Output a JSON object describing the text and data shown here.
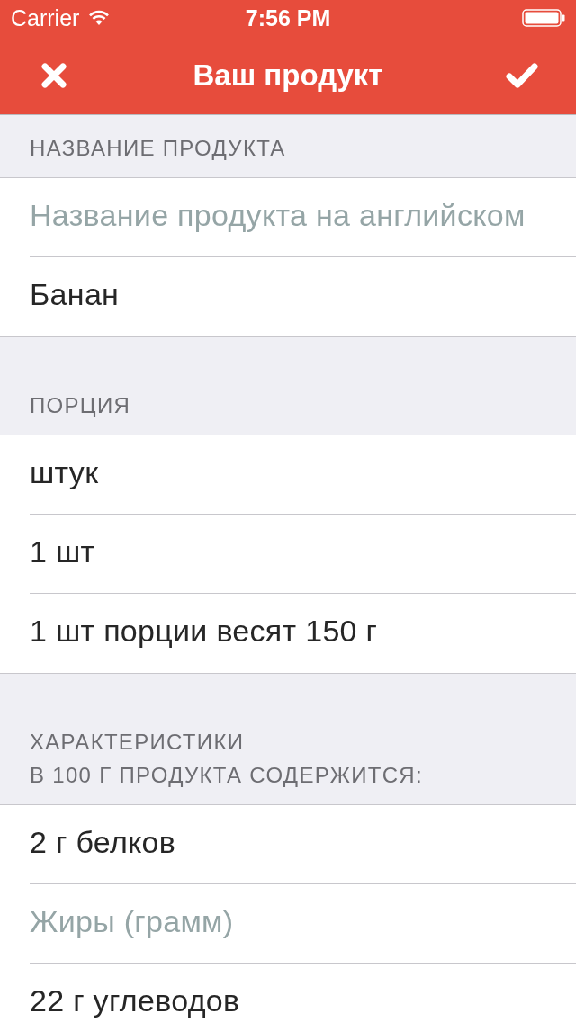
{
  "status_bar": {
    "carrier": "Carrier",
    "time": "7:56 PM"
  },
  "nav_bar": {
    "title": "Ваш продукт"
  },
  "sections": [
    {
      "header": [
        "НАЗВАНИЕ ПРОДУКТА"
      ],
      "fields": [
        {
          "placeholder": "Название продукта на английском"
        },
        {
          "value": "Банан"
        }
      ]
    },
    {
      "header": [
        "ПОРЦИЯ"
      ],
      "fields": [
        {
          "value": "штук"
        },
        {
          "value": "1 шт"
        },
        {
          "value": "1 шт порции весят 150 г"
        }
      ]
    },
    {
      "header": [
        "ХАРАКТЕРИСТИКИ",
        "В 100 Г ПРОДУКТА СОДЕРЖИТСЯ:"
      ],
      "fields": [
        {
          "value": "2 г белков"
        },
        {
          "placeholder": "Жиры (грамм)"
        },
        {
          "value": "22 г углеводов"
        }
      ]
    }
  ]
}
